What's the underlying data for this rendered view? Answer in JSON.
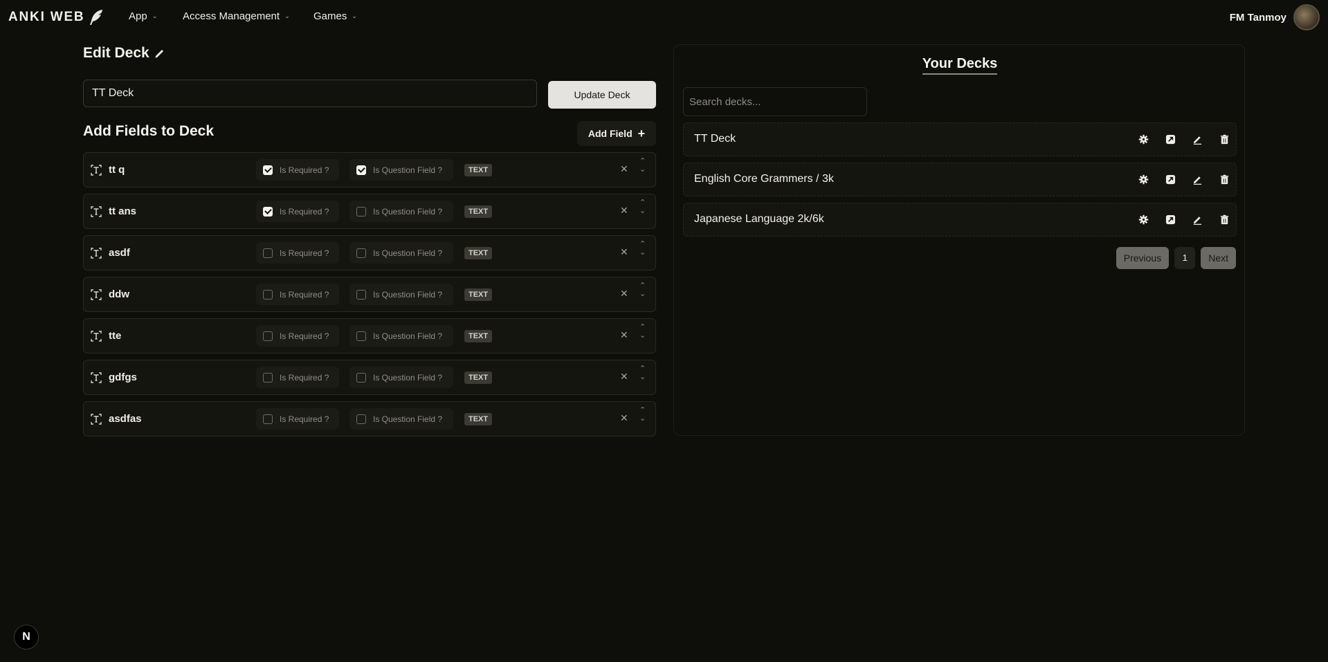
{
  "nav": {
    "brand": "ANKI WEB",
    "menus": [
      {
        "label": "App"
      },
      {
        "label": "Access Management"
      },
      {
        "label": "Games"
      }
    ],
    "user": "FM Tanmoy"
  },
  "edit": {
    "title": "Edit Deck",
    "deck_name_value": "TT Deck",
    "update_label": "Update Deck",
    "fields_title": "Add Fields to Deck",
    "add_field_label": "Add Field",
    "required_label": "Is Required ?",
    "question_label": "Is Question Field ?",
    "fields": [
      {
        "name": "tt q",
        "required": true,
        "question": true,
        "type": "TEXT"
      },
      {
        "name": "tt ans",
        "required": true,
        "question": false,
        "type": "TEXT"
      },
      {
        "name": "asdf",
        "required": false,
        "question": false,
        "type": "TEXT"
      },
      {
        "name": "ddw",
        "required": false,
        "question": false,
        "type": "TEXT"
      },
      {
        "name": "tte",
        "required": false,
        "question": false,
        "type": "TEXT"
      },
      {
        "name": "gdfgs",
        "required": false,
        "question": false,
        "type": "TEXT"
      },
      {
        "name": "asdfas",
        "required": false,
        "question": false,
        "type": "TEXT"
      }
    ]
  },
  "decks": {
    "title": "Your Decks",
    "search_placeholder": "Search decks...",
    "items": [
      {
        "name": "TT Deck"
      },
      {
        "name": "English Core Grammers / 3k"
      },
      {
        "name": "Japanese Language 2k/6k"
      }
    ],
    "pagination": {
      "previous": "Previous",
      "page": "1",
      "next": "Next"
    }
  },
  "framework_badge": "N",
  "colors": {
    "background": "#0e0e0a",
    "panel": "#15150f",
    "update_button": "#e4e3df"
  }
}
